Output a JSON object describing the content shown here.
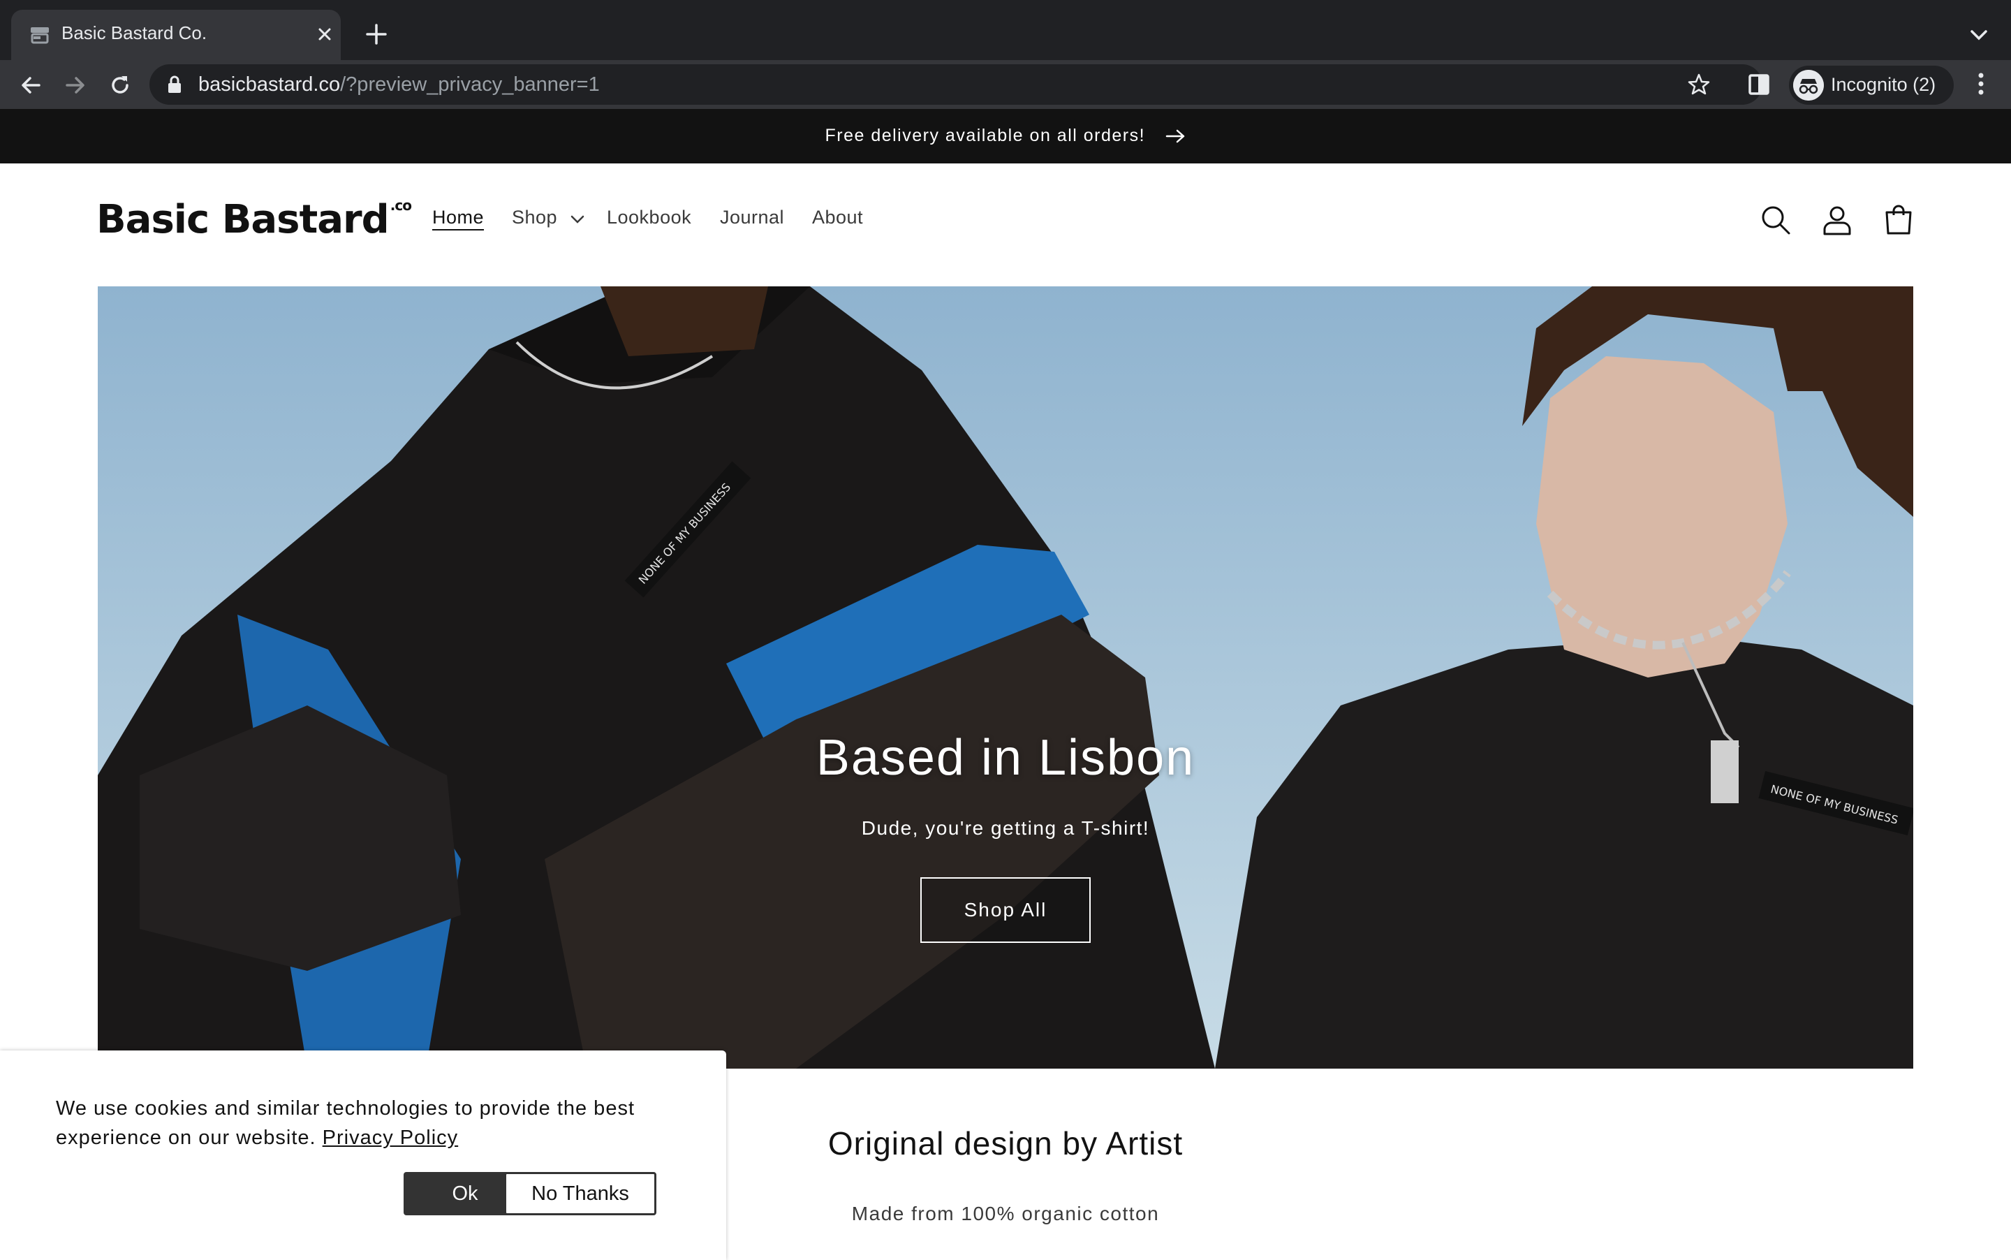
{
  "browser": {
    "tab_title": "Basic Bastard Co.",
    "url_host": "basicbastard.co",
    "url_rest": "/?preview_privacy_banner=1",
    "profile_label": "Incognito (2)"
  },
  "announcement": {
    "text": "Free delivery available on all orders!"
  },
  "header": {
    "logo": "Basic Bastard",
    "logo_suffix": ".co",
    "nav": {
      "home": "Home",
      "shop": "Shop",
      "lookbook": "Lookbook",
      "journal": "Journal",
      "about": "About"
    }
  },
  "hero": {
    "heading": "Based in Lisbon",
    "subheading": "Dude, you're getting a T-shirt!",
    "button": "Shop All",
    "garment_print": "NONE OF MY BUSINESS"
  },
  "section": {
    "title": "Original design by Artist",
    "subtitle": "Made from 100% organic cotton"
  },
  "cookie_banner": {
    "text": "We use cookies and similar technologies to provide the best experience on our website.",
    "link": "Privacy Policy",
    "ok": "Ok",
    "decline": "No Thanks"
  },
  "colors": {
    "chrome_dark": "#202124",
    "chrome_toolbar": "#35363a",
    "announcement_bg": "#121212",
    "sky": "#a9c6d8",
    "hoodie_blue": "#1f6fb8"
  }
}
